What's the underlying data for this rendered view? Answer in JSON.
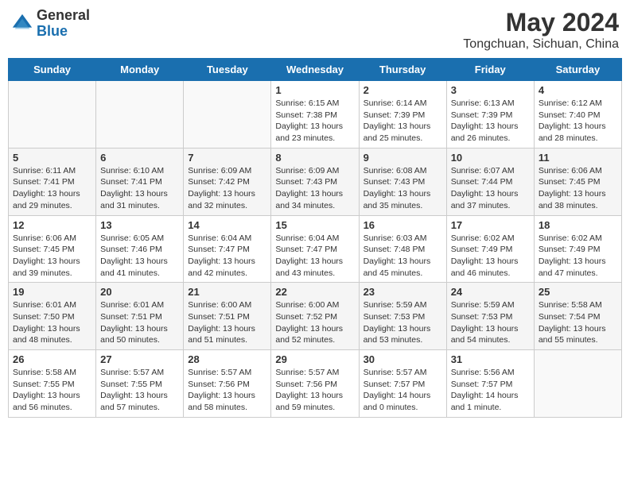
{
  "logo": {
    "general": "General",
    "blue": "Blue"
  },
  "title": {
    "month_year": "May 2024",
    "location": "Tongchuan, Sichuan, China"
  },
  "headers": [
    "Sunday",
    "Monday",
    "Tuesday",
    "Wednesday",
    "Thursday",
    "Friday",
    "Saturday"
  ],
  "weeks": [
    [
      {
        "day": "",
        "info": ""
      },
      {
        "day": "",
        "info": ""
      },
      {
        "day": "",
        "info": ""
      },
      {
        "day": "1",
        "info": "Sunrise: 6:15 AM\nSunset: 7:38 PM\nDaylight: 13 hours\nand 23 minutes."
      },
      {
        "day": "2",
        "info": "Sunrise: 6:14 AM\nSunset: 7:39 PM\nDaylight: 13 hours\nand 25 minutes."
      },
      {
        "day": "3",
        "info": "Sunrise: 6:13 AM\nSunset: 7:39 PM\nDaylight: 13 hours\nand 26 minutes."
      },
      {
        "day": "4",
        "info": "Sunrise: 6:12 AM\nSunset: 7:40 PM\nDaylight: 13 hours\nand 28 minutes."
      }
    ],
    [
      {
        "day": "5",
        "info": "Sunrise: 6:11 AM\nSunset: 7:41 PM\nDaylight: 13 hours\nand 29 minutes."
      },
      {
        "day": "6",
        "info": "Sunrise: 6:10 AM\nSunset: 7:41 PM\nDaylight: 13 hours\nand 31 minutes."
      },
      {
        "day": "7",
        "info": "Sunrise: 6:09 AM\nSunset: 7:42 PM\nDaylight: 13 hours\nand 32 minutes."
      },
      {
        "day": "8",
        "info": "Sunrise: 6:09 AM\nSunset: 7:43 PM\nDaylight: 13 hours\nand 34 minutes."
      },
      {
        "day": "9",
        "info": "Sunrise: 6:08 AM\nSunset: 7:43 PM\nDaylight: 13 hours\nand 35 minutes."
      },
      {
        "day": "10",
        "info": "Sunrise: 6:07 AM\nSunset: 7:44 PM\nDaylight: 13 hours\nand 37 minutes."
      },
      {
        "day": "11",
        "info": "Sunrise: 6:06 AM\nSunset: 7:45 PM\nDaylight: 13 hours\nand 38 minutes."
      }
    ],
    [
      {
        "day": "12",
        "info": "Sunrise: 6:06 AM\nSunset: 7:45 PM\nDaylight: 13 hours\nand 39 minutes."
      },
      {
        "day": "13",
        "info": "Sunrise: 6:05 AM\nSunset: 7:46 PM\nDaylight: 13 hours\nand 41 minutes."
      },
      {
        "day": "14",
        "info": "Sunrise: 6:04 AM\nSunset: 7:47 PM\nDaylight: 13 hours\nand 42 minutes."
      },
      {
        "day": "15",
        "info": "Sunrise: 6:04 AM\nSunset: 7:47 PM\nDaylight: 13 hours\nand 43 minutes."
      },
      {
        "day": "16",
        "info": "Sunrise: 6:03 AM\nSunset: 7:48 PM\nDaylight: 13 hours\nand 45 minutes."
      },
      {
        "day": "17",
        "info": "Sunrise: 6:02 AM\nSunset: 7:49 PM\nDaylight: 13 hours\nand 46 minutes."
      },
      {
        "day": "18",
        "info": "Sunrise: 6:02 AM\nSunset: 7:49 PM\nDaylight: 13 hours\nand 47 minutes."
      }
    ],
    [
      {
        "day": "19",
        "info": "Sunrise: 6:01 AM\nSunset: 7:50 PM\nDaylight: 13 hours\nand 48 minutes."
      },
      {
        "day": "20",
        "info": "Sunrise: 6:01 AM\nSunset: 7:51 PM\nDaylight: 13 hours\nand 50 minutes."
      },
      {
        "day": "21",
        "info": "Sunrise: 6:00 AM\nSunset: 7:51 PM\nDaylight: 13 hours\nand 51 minutes."
      },
      {
        "day": "22",
        "info": "Sunrise: 6:00 AM\nSunset: 7:52 PM\nDaylight: 13 hours\nand 52 minutes."
      },
      {
        "day": "23",
        "info": "Sunrise: 5:59 AM\nSunset: 7:53 PM\nDaylight: 13 hours\nand 53 minutes."
      },
      {
        "day": "24",
        "info": "Sunrise: 5:59 AM\nSunset: 7:53 PM\nDaylight: 13 hours\nand 54 minutes."
      },
      {
        "day": "25",
        "info": "Sunrise: 5:58 AM\nSunset: 7:54 PM\nDaylight: 13 hours\nand 55 minutes."
      }
    ],
    [
      {
        "day": "26",
        "info": "Sunrise: 5:58 AM\nSunset: 7:55 PM\nDaylight: 13 hours\nand 56 minutes."
      },
      {
        "day": "27",
        "info": "Sunrise: 5:57 AM\nSunset: 7:55 PM\nDaylight: 13 hours\nand 57 minutes."
      },
      {
        "day": "28",
        "info": "Sunrise: 5:57 AM\nSunset: 7:56 PM\nDaylight: 13 hours\nand 58 minutes."
      },
      {
        "day": "29",
        "info": "Sunrise: 5:57 AM\nSunset: 7:56 PM\nDaylight: 13 hours\nand 59 minutes."
      },
      {
        "day": "30",
        "info": "Sunrise: 5:57 AM\nSunset: 7:57 PM\nDaylight: 14 hours\nand 0 minutes."
      },
      {
        "day": "31",
        "info": "Sunrise: 5:56 AM\nSunset: 7:57 PM\nDaylight: 14 hours\nand 1 minute."
      },
      {
        "day": "",
        "info": ""
      }
    ]
  ]
}
